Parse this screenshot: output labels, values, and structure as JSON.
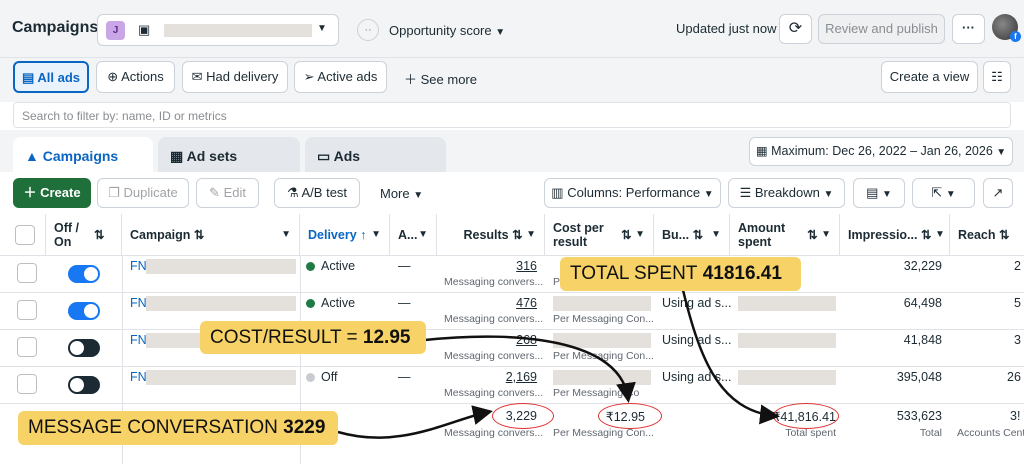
{
  "header": {
    "title": "Campaigns",
    "account_initial": "J",
    "opportunity_label": "Opportunity score",
    "updated": "Updated just now",
    "review_label": "Review and publish",
    "more_label": "···"
  },
  "filters": {
    "all_ads": "All ads",
    "actions": "Actions",
    "had_delivery": "Had delivery",
    "active_ads": "Active ads",
    "see_more": "See more",
    "create_view": "Create a view"
  },
  "search": {
    "placeholder": "Search to filter by: name, ID or metrics"
  },
  "tabs": [
    {
      "label": "Campaigns"
    },
    {
      "label": "Ad sets"
    },
    {
      "label": "Ads"
    }
  ],
  "date_range": "Maximum: Dec 26, 2022 – Jan 26, 2026",
  "toolbar": {
    "create": "Create",
    "duplicate": "Duplicate",
    "edit": "Edit",
    "ab_test": "A/B test",
    "more": "More",
    "columns": "Columns: Performance",
    "breakdown": "Breakdown"
  },
  "columns": {
    "offon": "Off / On",
    "campaign": "Campaign",
    "delivery": "Delivery",
    "a": "A...",
    "results": "Results",
    "cost": "Cost per result",
    "bu": "Bu...",
    "amount": "Amount spent",
    "impressions": "Impressio...",
    "reach": "Reach"
  },
  "rows": [
    {
      "name": "FN",
      "delivery": "Active",
      "dash": "—",
      "results": "316",
      "results_sub": "Messaging convers...",
      "cost_sub": "Pe",
      "bid": "",
      "impressions": "32,229",
      "reach": "2"
    },
    {
      "name": "FN",
      "delivery": "Active",
      "dash": "—",
      "results": "476",
      "results_sub": "Messaging convers...",
      "cost_sub": "Per Messaging Con...",
      "bid": "Using ad s...",
      "impressions": "64,498",
      "reach": "5"
    },
    {
      "name": "FN",
      "delivery": "",
      "dash": "",
      "results": "268",
      "results_sub": "Messaging convers...",
      "cost_sub": "Per Messaging Con...",
      "bid": "Using ad s...",
      "impressions": "41,848",
      "reach": "3"
    },
    {
      "name": "FN",
      "delivery": "Off",
      "dash": "—",
      "results": "2,169",
      "results_sub": "Messaging convers...",
      "cost_sub": "Per Messaging Co",
      "bid": "Using ad s...",
      "impressions": "395,048",
      "reach": "26"
    }
  ],
  "totals": {
    "results": "3,229",
    "results_sub": "Messaging convers...",
    "cost": "₹12.95",
    "cost_sub": "Per Messaging Con...",
    "amount": "₹41,816.41",
    "amount_sub": "Total spent",
    "impressions": "533,623",
    "impressions_sub": "Total",
    "reach": "3!",
    "reach_sub": "Accounts Cent"
  },
  "callouts": {
    "total_spent": "TOTAL SPENT",
    "total_spent_val": "41816.41",
    "cost_result": "COST/RESULT =",
    "cost_result_val": "12.95",
    "message_conv": "MESSAGE CONVERSATION",
    "message_conv_val": "3229"
  },
  "colors": {
    "accent": "#0a66c2",
    "callout": "#f7d267",
    "create": "#1f6f3a",
    "toggle_on": "#1877f2",
    "toggle_off": "#1c2b33",
    "active_dot": "#1f7a45"
  }
}
